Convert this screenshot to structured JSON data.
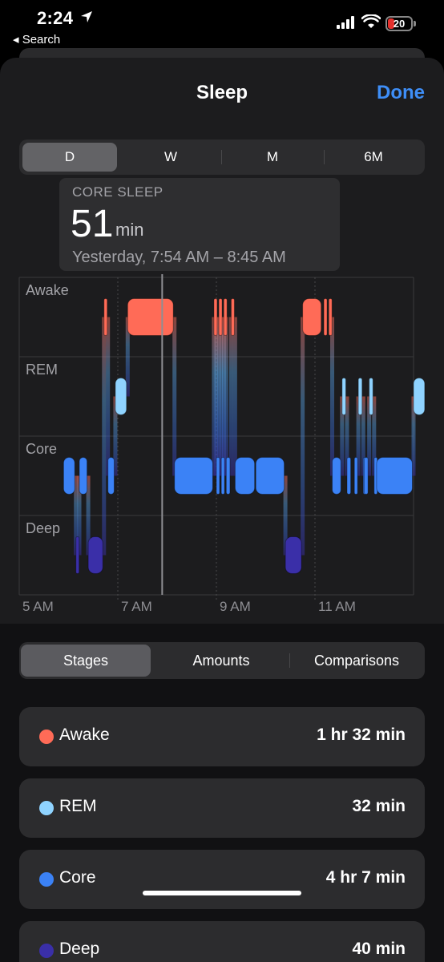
{
  "status": {
    "time": "2:24",
    "back_label": "Search",
    "battery": "20"
  },
  "nav": {
    "title": "Sleep",
    "done_label": "Done"
  },
  "range_tabs": [
    {
      "label": "D",
      "selected": true
    },
    {
      "label": "W",
      "selected": false
    },
    {
      "label": "M",
      "selected": false
    },
    {
      "label": "6M",
      "selected": false
    }
  ],
  "tooltip": {
    "stage": "CORE SLEEP",
    "value": "51",
    "unit": "min",
    "range": "Yesterday, 7:54 AM – 8:45 AM"
  },
  "chart_data": {
    "type": "timeline",
    "stages": [
      "Awake",
      "REM",
      "Core",
      "Deep"
    ],
    "x_ticks": [
      "5 AM",
      "7 AM",
      "9 AM",
      "11 AM"
    ],
    "x_range_hours": [
      5.0,
      13.0
    ],
    "selected_segment": {
      "stage": "Core",
      "start": "7:54 AM",
      "end": "8:45 AM"
    },
    "segments": [
      {
        "stage": "Core",
        "start": 5.9,
        "end": 6.15
      },
      {
        "stage": "Deep",
        "start": 6.15,
        "end": 6.22
      },
      {
        "stage": "Core",
        "start": 6.22,
        "end": 6.4
      },
      {
        "stage": "Deep",
        "start": 6.4,
        "end": 6.72
      },
      {
        "stage": "Awake",
        "start": 6.72,
        "end": 6.8
      },
      {
        "stage": "Core",
        "start": 6.8,
        "end": 6.95
      },
      {
        "stage": "REM",
        "start": 6.95,
        "end": 7.2
      },
      {
        "stage": "Awake",
        "start": 7.2,
        "end": 8.15
      },
      {
        "stage": "Core",
        "start": 8.15,
        "end": 8.95
      },
      {
        "stage": "Awake",
        "start": 8.95,
        "end": 9.0
      },
      {
        "stage": "Core",
        "start": 9.0,
        "end": 9.05
      },
      {
        "stage": "Awake",
        "start": 9.05,
        "end": 9.1
      },
      {
        "stage": "Core",
        "start": 9.1,
        "end": 9.15
      },
      {
        "stage": "Awake",
        "start": 9.15,
        "end": 9.2
      },
      {
        "stage": "Core",
        "start": 9.2,
        "end": 9.3
      },
      {
        "stage": "Awake",
        "start": 9.3,
        "end": 9.38
      },
      {
        "stage": "Core",
        "start": 9.38,
        "end": 9.8
      },
      {
        "stage": "Core",
        "start": 9.8,
        "end": 10.4
      },
      {
        "stage": "Deep",
        "start": 10.4,
        "end": 10.75
      },
      {
        "stage": "Awake",
        "start": 10.75,
        "end": 11.15
      },
      {
        "stage": "Awake",
        "start": 11.18,
        "end": 11.25
      },
      {
        "stage": "Awake",
        "start": 11.28,
        "end": 11.35
      },
      {
        "stage": "Core",
        "start": 11.35,
        "end": 11.55
      },
      {
        "stage": "REM",
        "start": 11.55,
        "end": 11.65
      },
      {
        "stage": "Core",
        "start": 11.65,
        "end": 11.75
      },
      {
        "stage": "Core",
        "start": 11.8,
        "end": 11.88
      },
      {
        "stage": "REM",
        "start": 11.88,
        "end": 11.98
      },
      {
        "stage": "Core",
        "start": 11.98,
        "end": 12.0
      },
      {
        "stage": "Core",
        "start": 12.0,
        "end": 12.1
      },
      {
        "stage": "REM",
        "start": 12.1,
        "end": 12.2
      },
      {
        "stage": "Core",
        "start": 12.2,
        "end": 12.25
      },
      {
        "stage": "Core",
        "start": 12.25,
        "end": 13.0
      },
      {
        "stage": "REM",
        "start": 13.0,
        "end": 13.25
      }
    ]
  },
  "stage_tabs": [
    {
      "label": "Stages",
      "selected": true
    },
    {
      "label": "Amounts",
      "selected": false
    },
    {
      "label": "Comparisons",
      "selected": false
    }
  ],
  "stage_rows": [
    {
      "label": "Awake",
      "value": "1 hr 32 min",
      "color": "#ff6b57"
    },
    {
      "label": "REM",
      "value": "32 min",
      "color": "#8fd3ff"
    },
    {
      "label": "Core",
      "value": "4 hr 7 min",
      "color": "#3b82f6"
    },
    {
      "label": "Deep",
      "value": "40 min",
      "color": "#3a2fa8"
    }
  ]
}
